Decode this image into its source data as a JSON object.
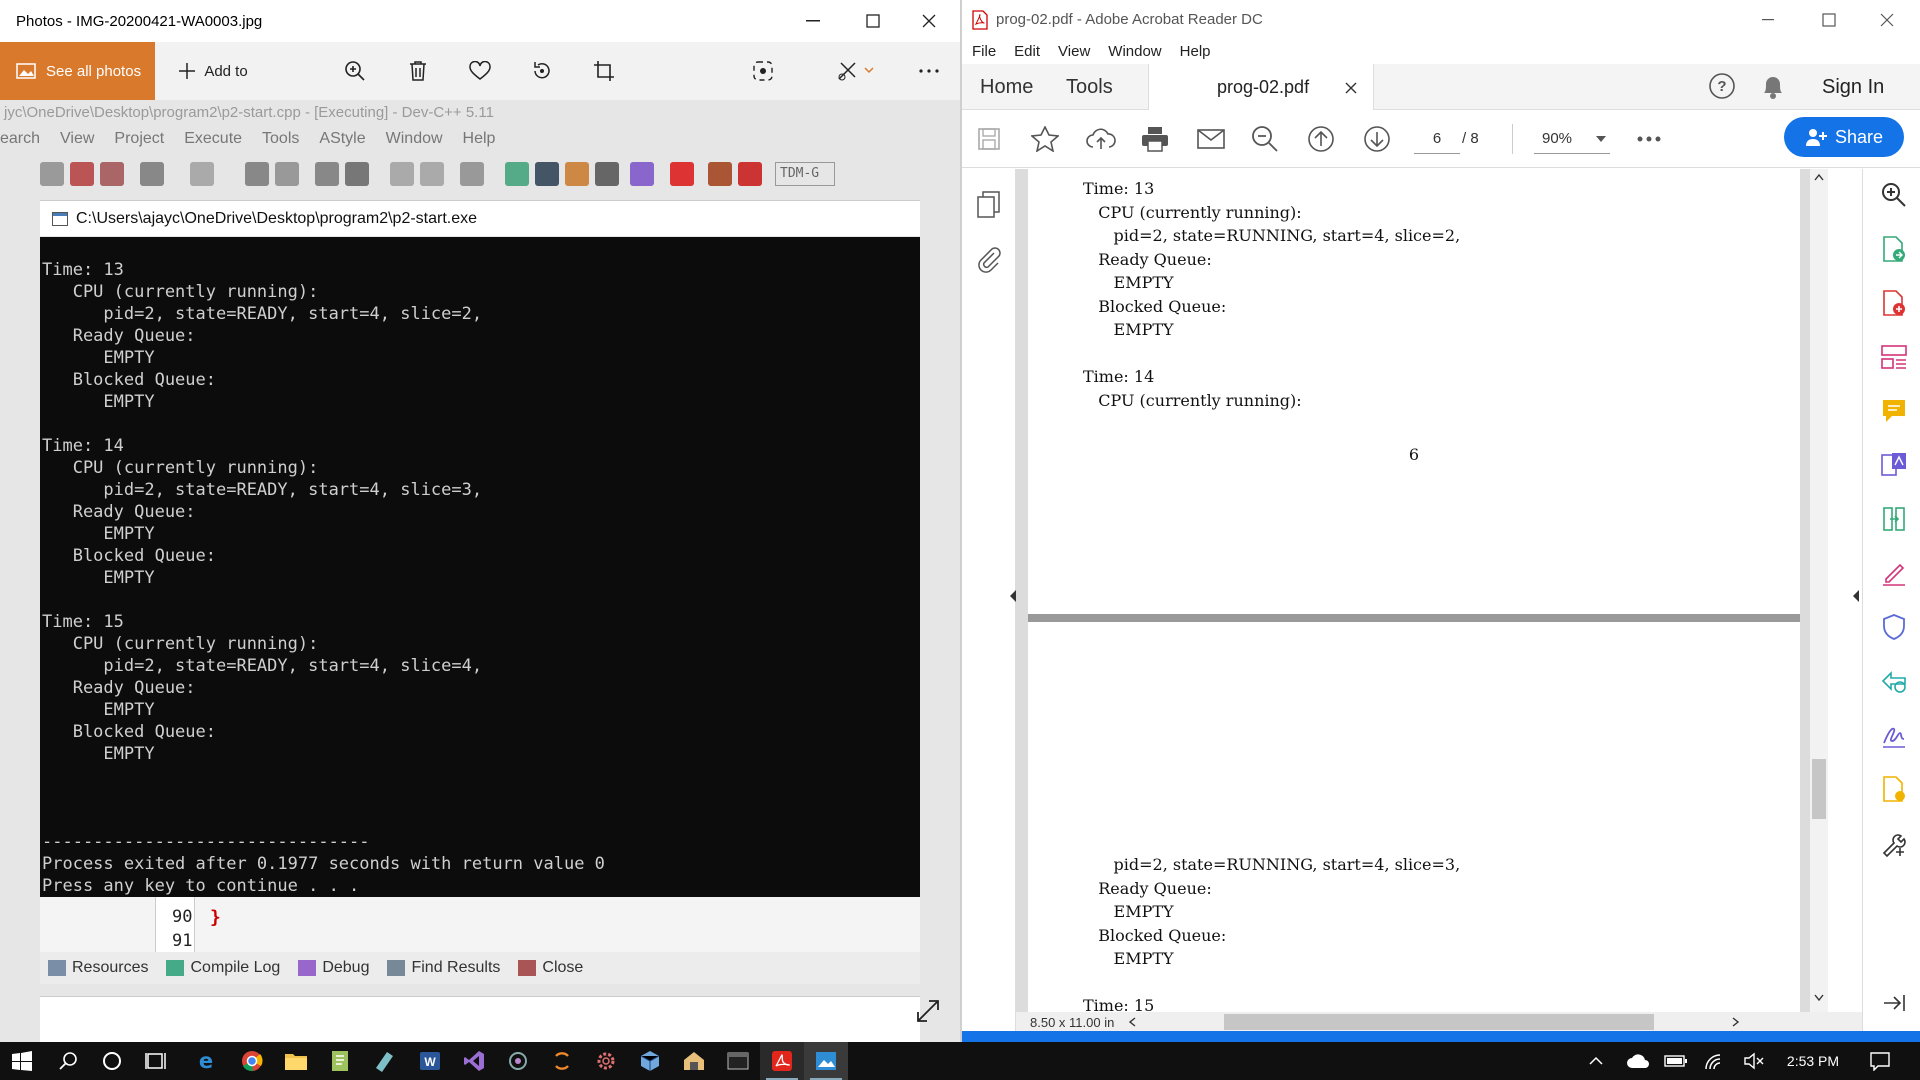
{
  "photos": {
    "title": "Photos - IMG-20200421-WA0003.jpg",
    "see_all": "See all photos",
    "add_to": "Add to",
    "photo": {
      "devcpp_title": "jyc\\OneDrive\\Desktop\\program2\\p2-start.cpp - [Executing] - Dev-C++ 5.11",
      "devcpp_menu": [
        "earch",
        "View",
        "Project",
        "Execute",
        "Tools",
        "AStyle",
        "Window",
        "Help"
      ],
      "tdm_label": "TDM-G",
      "console_title": "C:\\Users\\ajayc\\OneDrive\\Desktop\\program2\\p2-start.exe",
      "console_lines": [
        "Time: 13",
        "   CPU (currently running):",
        "      pid=2, state=READY, start=4, slice=2,",
        "   Ready Queue:",
        "      EMPTY",
        "   Blocked Queue:",
        "      EMPTY",
        "",
        "Time: 14",
        "   CPU (currently running):",
        "      pid=2, state=READY, start=4, slice=3,",
        "   Ready Queue:",
        "      EMPTY",
        "   Blocked Queue:",
        "      EMPTY",
        "",
        "Time: 15",
        "   CPU (currently running):",
        "      pid=2, state=READY, start=4, slice=4,",
        "   Ready Queue:",
        "      EMPTY",
        "   Blocked Queue:",
        "      EMPTY",
        "",
        "",
        "",
        "--------------------------------",
        "Process exited after 0.1977 seconds with return value 0",
        "Press any key to continue . . ."
      ],
      "line_numbers": [
        "90",
        "91"
      ],
      "bottom_tabs": [
        "Resources",
        "Compile Log",
        "Debug",
        "Find Results",
        "Close"
      ]
    }
  },
  "acrobat": {
    "title": "prog-02.pdf - Adobe Acrobat Reader DC",
    "menu": [
      "File",
      "Edit",
      "View",
      "Window",
      "Help"
    ],
    "tab_home": "Home",
    "tab_tools": "Tools",
    "doc_tab": "prog-02.pdf",
    "sign_in": "Sign In",
    "page_current": "6",
    "page_total": "/ 8",
    "zoom": "90%",
    "share": "Share",
    "page_a_lines": [
      "Time: 13",
      "   CPU (currently running):",
      "      pid=2, state=RUNNING, start=4, slice=2,",
      "   Ready Queue:",
      "      EMPTY",
      "   Blocked Queue:",
      "      EMPTY",
      "",
      "Time: 14",
      "   CPU (currently running):"
    ],
    "page_number": "6",
    "page_b_lines": [
      "      pid=2, state=RUNNING, start=4, slice=3,",
      "   Ready Queue:",
      "      EMPTY",
      "   Blocked Queue:",
      "      EMPTY",
      "",
      "Time: 15"
    ],
    "page_size": "8.50 x 11.00 in"
  },
  "taskbar": {
    "time": "2:53 PM"
  },
  "colors": {
    "photos_accent": "#d9792c",
    "acrobat_blue": "#1473e6",
    "console_bg": "#0c0c0c"
  }
}
